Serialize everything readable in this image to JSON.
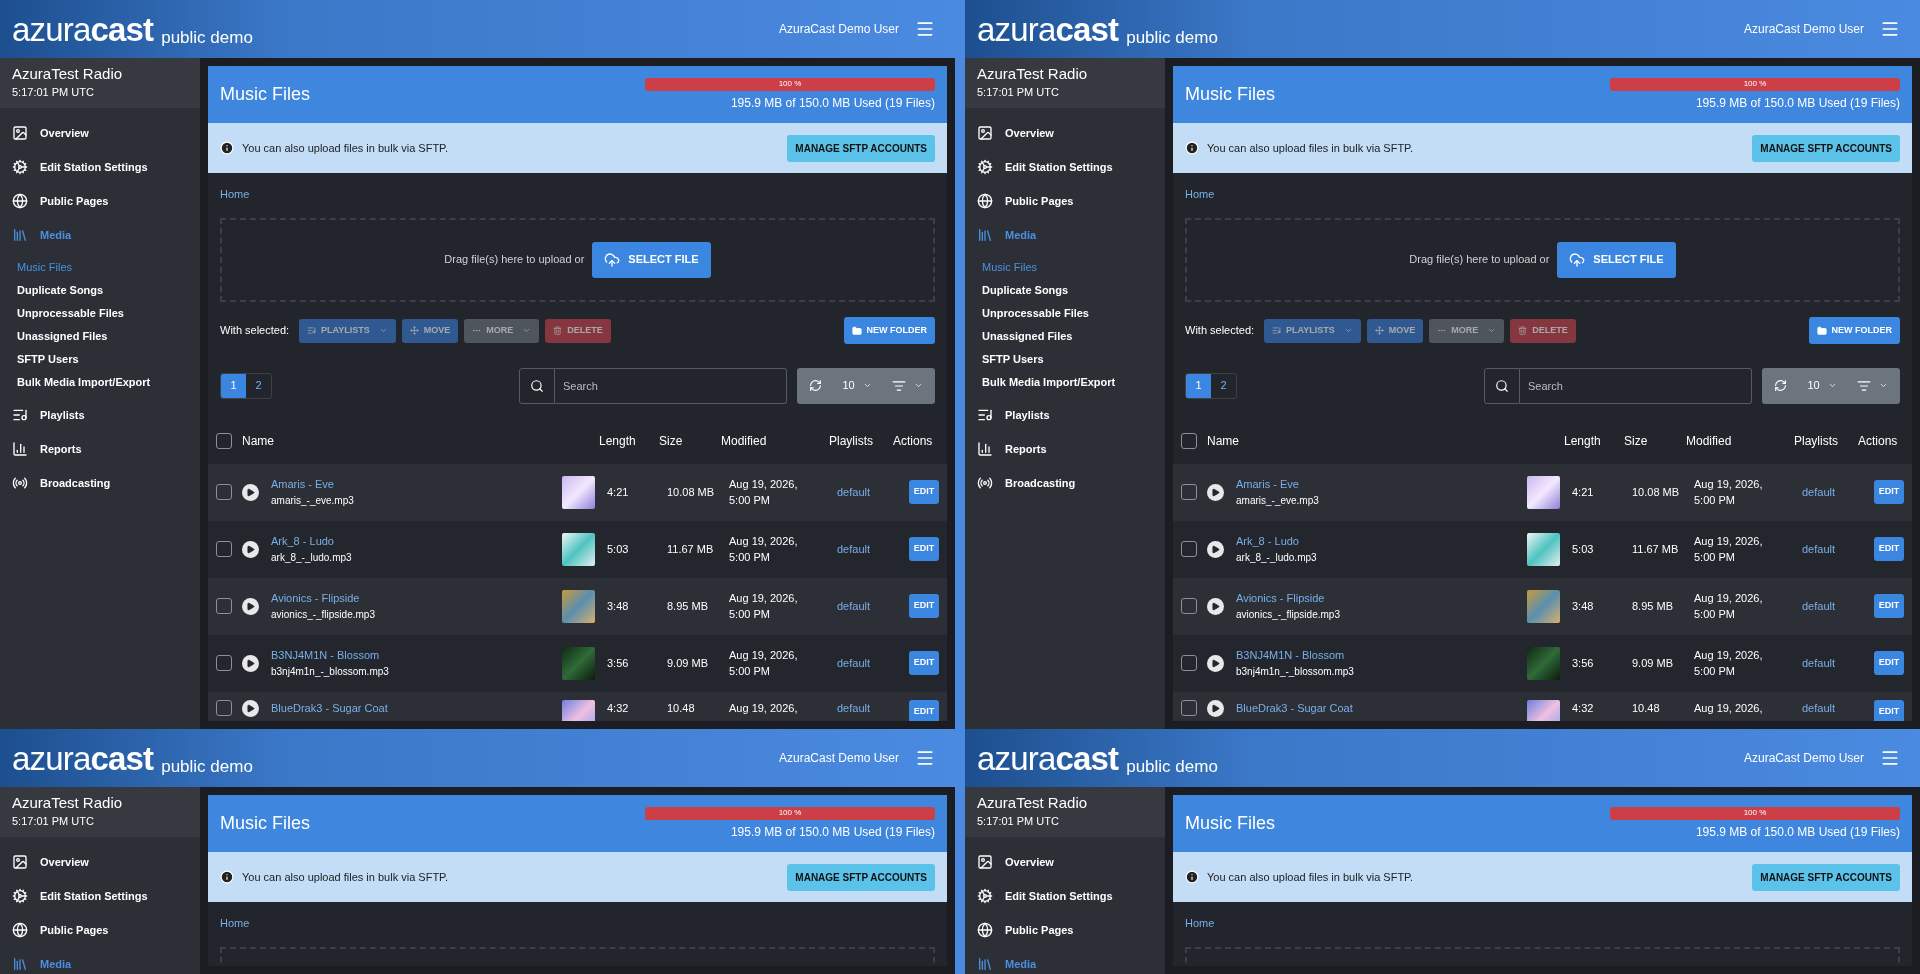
{
  "panels": [
    {
      "header": {
        "logo": "azura**cast**",
        "tagline": "public demo",
        "user": "AzuraCast Demo User"
      },
      "station": {
        "name": "AzuraTest Radio",
        "time": "5:17:01 PM UTC"
      },
      "sidebar": [
        {
          "label": "Overview",
          "selected": false
        },
        {
          "label": "Edit Station Settings",
          "selected": false
        },
        {
          "label": "Public Pages",
          "selected": false
        },
        {
          "label": "Media",
          "selected": true,
          "children": [
            {
              "label": "Music Files",
              "selected": true
            },
            {
              "label": "Duplicate Songs",
              "selected": false
            },
            {
              "label": "Unprocessable Files",
              "selected": false
            },
            {
              "label": "Unassigned Files",
              "selected": false
            },
            {
              "label": "SFTP Users",
              "selected": false
            },
            {
              "label": "Bulk Media Import/Export",
              "selected": false
            }
          ]
        },
        {
          "label": "Playlists",
          "selected": false
        },
        {
          "label": "Reports",
          "selected": false
        },
        {
          "label": "Broadcasting",
          "selected": false
        }
      ],
      "page": {
        "title": "Music Files",
        "usage": {
          "level": 1,
          "label": "100 %",
          "text": "195.9 MB of 150.0 MB Used (19 Files)"
        },
        "info": {
          "text": "You can also upload files in bulk via SFTP.",
          "button": "MANAGE SFTP ACCOUNTS"
        },
        "breadcrumb": "Home",
        "dropzone": {
          "text": "Drag file(s) here to upload or",
          "button": "SELECT FILE"
        },
        "toolbar": {
          "label": "With selected:",
          "buttons": [
            {
              "label": "PLAYLISTS",
              "kind": "primary",
              "dropdown": true,
              "disabled": true
            },
            {
              "label": "MOVE",
              "kind": "primary",
              "dropdown": false,
              "disabled": true
            },
            {
              "label": "MORE",
              "kind": "secondary",
              "dropdown": true,
              "disabled": true
            },
            {
              "label": "DELETE",
              "kind": "danger",
              "dropdown": false,
              "disabled": true
            }
          ],
          "new_folder": "NEW FOLDER"
        },
        "pages": [
          {
            "label": "1",
            "selected": true
          },
          {
            "label": "2",
            "selected": false
          }
        ],
        "search": {
          "placeholder": "Search"
        },
        "per_page": "10",
        "table": {
          "all_checked": false,
          "columns": [
            "Name",
            "Length",
            "Size",
            "Modified",
            "Playlists",
            "Actions"
          ],
          "rows": [
            {
              "checked": false,
              "title": "Amaris - Eve",
              "file": "amaris_-_eve.mp3",
              "length": "4:21",
              "size": "10.08 MB",
              "modified": "Aug 19, 2026, 5:00 PM",
              "playlist": "default",
              "action": "EDIT"
            },
            {
              "checked": false,
              "title": "Ark_8 - Ludo",
              "file": "ark_8_-_ludo.mp3",
              "length": "5:03",
              "size": "11.67 MB",
              "modified": "Aug 19, 2026, 5:00 PM",
              "playlist": "default",
              "action": "EDIT"
            },
            {
              "checked": false,
              "title": "Avionics - Flipside",
              "file": "avionics_-_flipside.mp3",
              "length": "3:48",
              "size": "8.95 MB",
              "modified": "Aug 19, 2026, 5:00 PM",
              "playlist": "default",
              "action": "EDIT"
            },
            {
              "checked": false,
              "title": "B3NJ4M1N - Blossom",
              "file": "b3nj4m1n_-_blossom.mp3",
              "length": "3:56",
              "size": "9.09 MB",
              "modified": "Aug 19, 2026, 5:00 PM",
              "playlist": "default",
              "action": "EDIT"
            },
            {
              "checked": false,
              "title": "BlueDrak3 - Sugar Coat",
              "length": "4:32",
              "size": "10.48",
              "modified": "Aug 19, 2026,",
              "playlist": "default",
              "action": "EDIT"
            }
          ]
        }
      }
    },
    {
      "header": {
        "logo": "azura**cast**",
        "tagline": "public demo",
        "user": "AzuraCast Demo User"
      },
      "station": {
        "name": "AzuraTest Radio",
        "time": "5:17:01 PM UTC"
      },
      "sidebar": [
        {
          "label": "Overview",
          "selected": false
        },
        {
          "label": "Edit Station Settings",
          "selected": false
        },
        {
          "label": "Public Pages",
          "selected": false
        },
        {
          "label": "Media",
          "selected": true,
          "children": [
            {
              "label": "Music Files",
              "selected": true
            },
            {
              "label": "Duplicate Songs",
              "selected": false
            },
            {
              "label": "Unprocessable Files",
              "selected": false
            },
            {
              "label": "Unassigned Files",
              "selected": false
            },
            {
              "label": "SFTP Users",
              "selected": false
            },
            {
              "label": "Bulk Media Import/Export",
              "selected": false
            }
          ]
        },
        {
          "label": "Playlists",
          "selected": false
        },
        {
          "label": "Reports",
          "selected": false
        },
        {
          "label": "Broadcasting",
          "selected": false
        }
      ],
      "page": {
        "title": "Music Files",
        "usage": {
          "level": 1,
          "label": "100 %",
          "text": "195.9 MB of 150.0 MB Used (19 Files)"
        },
        "info": {
          "text": "You can also upload files in bulk via SFTP.",
          "button": "MANAGE SFTP ACCOUNTS"
        },
        "breadcrumb": "Home",
        "dropzone": {
          "text": "Drag file(s) here to upload or",
          "button": "SELECT FILE"
        },
        "toolbar": {
          "label": "With selected:",
          "buttons": [
            {
              "label": "PLAYLISTS",
              "kind": "primary",
              "dropdown": true,
              "disabled": true
            },
            {
              "label": "MOVE",
              "kind": "primary",
              "dropdown": false,
              "disabled": true
            },
            {
              "label": "MORE",
              "kind": "secondary",
              "dropdown": true,
              "disabled": true
            },
            {
              "label": "DELETE",
              "kind": "danger",
              "dropdown": false,
              "disabled": true
            }
          ],
          "new_folder": "NEW FOLDER"
        },
        "pages": [
          {
            "label": "1",
            "selected": true
          },
          {
            "label": "2",
            "selected": false
          }
        ],
        "search": {
          "placeholder": "Search"
        },
        "per_page": "10",
        "table": {
          "all_checked": false,
          "columns": [
            "Name",
            "Length",
            "Size",
            "Modified",
            "Playlists",
            "Actions"
          ],
          "rows": [
            {
              "checked": false,
              "title": "Amaris - Eve",
              "file": "amaris_-_eve.mp3",
              "length": "4:21",
              "size": "10.08 MB",
              "modified": "Aug 19, 2026, 5:00 PM",
              "playlist": "default",
              "action": "EDIT"
            },
            {
              "checked": false,
              "title": "Ark_8 - Ludo",
              "file": "ark_8_-_ludo.mp3",
              "length": "5:03",
              "size": "11.67 MB",
              "modified": "Aug 19, 2026, 5:00 PM",
              "playlist": "default",
              "action": "EDIT"
            },
            {
              "checked": false,
              "title": "Avionics - Flipside",
              "file": "avionics_-_flipside.mp3",
              "length": "3:48",
              "size": "8.95 MB",
              "modified": "Aug 19, 2026, 5:00 PM",
              "playlist": "default",
              "action": "EDIT"
            },
            {
              "checked": false,
              "title": "B3NJ4M1N - Blossom",
              "file": "b3nj4m1n_-_blossom.mp3",
              "length": "3:56",
              "size": "9.09 MB",
              "modified": "Aug 19, 2026, 5:00 PM",
              "playlist": "default",
              "action": "EDIT"
            },
            {
              "checked": false,
              "title": "BlueDrak3 - Sugar Coat",
              "length": "4:32",
              "size": "10.48",
              "modified": "Aug 19, 2026,",
              "playlist": "default",
              "action": "EDIT"
            }
          ]
        }
      }
    },
    {
      "header": {
        "logo": "azura**cast**",
        "tagline": "public demo",
        "user": "AzuraCast Demo User"
      },
      "station": {
        "name": "AzuraTest Radio",
        "time": "5:17:01 PM UTC"
      },
      "sidebar": [
        {
          "label": "Overview",
          "selected": false
        },
        {
          "label": "Edit Station Settings",
          "selected": false
        },
        {
          "label": "Public Pages",
          "selected": false
        },
        {
          "label": "Media",
          "selected": true
        }
      ],
      "page": {
        "title": "Music Files",
        "usage": {
          "level": 1,
          "label": "100 %",
          "text": "195.9 MB of 150.0 MB Used (19 Files)"
        },
        "info": {
          "text": "You can also upload files in bulk via SFTP.",
          "button": "MANAGE SFTP ACCOUNTS"
        },
        "breadcrumb": "Home"
      }
    },
    {
      "header": {
        "logo": "azura**cast**",
        "tagline": "public demo",
        "user": "AzuraCast Demo User"
      },
      "station": {
        "name": "AzuraTest Radio",
        "time": "5:17:01 PM UTC"
      },
      "sidebar": [
        {
          "label": "Overview",
          "selected": false
        },
        {
          "label": "Edit Station Settings",
          "selected": false
        },
        {
          "label": "Public Pages",
          "selected": false
        },
        {
          "label": "Media",
          "selected": true
        }
      ],
      "page": {
        "title": "Music Files",
        "usage": {
          "level": 1,
          "label": "100 %",
          "text": "195.9 MB of 150.0 MB Used (19 Files)"
        },
        "info": {
          "text": "You can also upload files in bulk via SFTP.",
          "button": "MANAGE SFTP ACCOUNTS"
        },
        "breadcrumb": "Home"
      }
    }
  ]
}
